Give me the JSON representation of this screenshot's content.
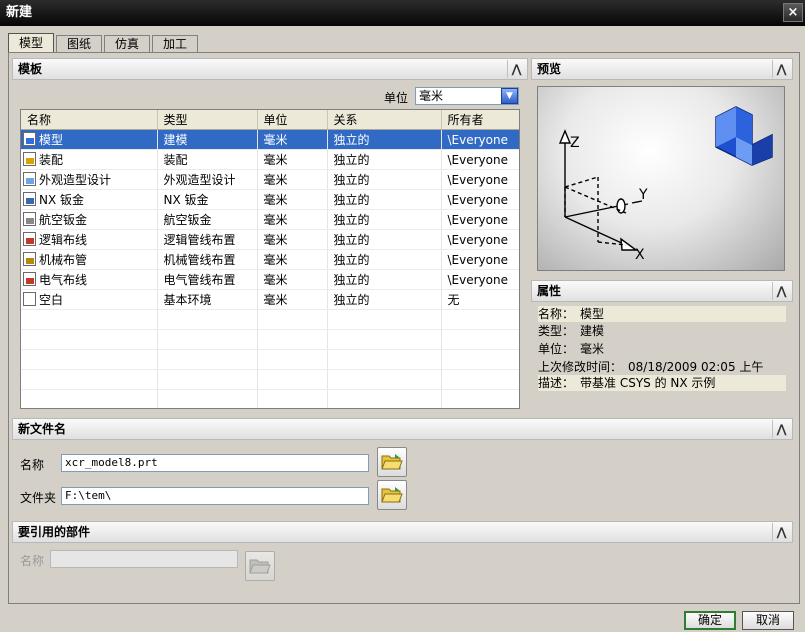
{
  "window": {
    "title": "新建",
    "close_glyph": "×"
  },
  "tabs": [
    {
      "label": "模型",
      "active": true
    },
    {
      "label": "图纸"
    },
    {
      "label": "仿真"
    },
    {
      "label": "加工"
    }
  ],
  "templates": {
    "header": "模板",
    "unit_label": "单位",
    "unit_value": "毫米",
    "columns": [
      "名称",
      "类型",
      "单位",
      "关系",
      "所有者"
    ],
    "rows": [
      {
        "name": "模型",
        "type": "建模",
        "unit": "毫米",
        "relation": "独立的",
        "owner": "\\Everyone",
        "icon": "model-template-icon",
        "icon_color": "#2f6fe0"
      },
      {
        "name": "装配",
        "type": "装配",
        "unit": "毫米",
        "relation": "独立的",
        "owner": "\\Everyone",
        "icon": "assembly-template-icon",
        "icon_color": "#d9a400"
      },
      {
        "name": "外观造型设计",
        "type": "外观造型设计",
        "unit": "毫米",
        "relation": "独立的",
        "owner": "\\Everyone",
        "icon": "shape-studio-template-icon",
        "icon_color": "#6aa6e8"
      },
      {
        "name": "NX 钣金",
        "type": "NX 钣金",
        "unit": "毫米",
        "relation": "独立的",
        "owner": "\\Everyone",
        "icon": "sheet-metal-template-icon",
        "icon_color": "#3b66b0"
      },
      {
        "name": "航空钣金",
        "type": "航空钣金",
        "unit": "毫米",
        "relation": "独立的",
        "owner": "\\Everyone",
        "icon": "aero-sheet-metal-template-icon",
        "icon_color": "#888888"
      },
      {
        "name": "逻辑布线",
        "type": "逻辑管线布置",
        "unit": "毫米",
        "relation": "独立的",
        "owner": "\\Everyone",
        "icon": "logical-routing-template-icon",
        "icon_color": "#c0392b"
      },
      {
        "name": "机械布管",
        "type": "机械管线布置",
        "unit": "毫米",
        "relation": "独立的",
        "owner": "\\Everyone",
        "icon": "mechanical-routing-template-icon",
        "icon_color": "#b8860b"
      },
      {
        "name": "电气布线",
        "type": "电气管线布置",
        "unit": "毫米",
        "relation": "独立的",
        "owner": "\\Everyone",
        "icon": "electrical-routing-template-icon",
        "icon_color": "#c0392b"
      },
      {
        "name": "空白",
        "type": "基本环境",
        "unit": "毫米",
        "relation": "独立的",
        "owner": "无",
        "icon": "blank-template-icon",
        "icon_color": "#ffffff"
      }
    ],
    "selected_index": 0
  },
  "preview": {
    "header": "预览",
    "axes": {
      "z": "Z",
      "y": "Y",
      "x": "X"
    },
    "icon": "model-3d-block-icon"
  },
  "properties": {
    "header": "属性",
    "name_label": "名称：",
    "name_value": "模型",
    "type_label": "类型：",
    "type_value": "建模",
    "unit_label": "单位：",
    "unit_value": "毫米",
    "modified_label": "上次修改时间：",
    "modified_value": "08/18/2009 02:05 上午",
    "desc_label": "描述：",
    "desc_value": "带基准 CSYS 的 NX 示例"
  },
  "new_file": {
    "header": "新文件名",
    "name_label": "名称",
    "name_value": "xcr_model8.prt",
    "folder_label": "文件夹",
    "folder_value": "F:\\tem\\"
  },
  "referenced": {
    "header": "要引用的部件",
    "name_label": "名称",
    "name_value": ""
  },
  "buttons": {
    "ok": "确定",
    "cancel": "取消"
  },
  "colors": {
    "selection": "#316ac5",
    "titlebar": "#060606"
  }
}
